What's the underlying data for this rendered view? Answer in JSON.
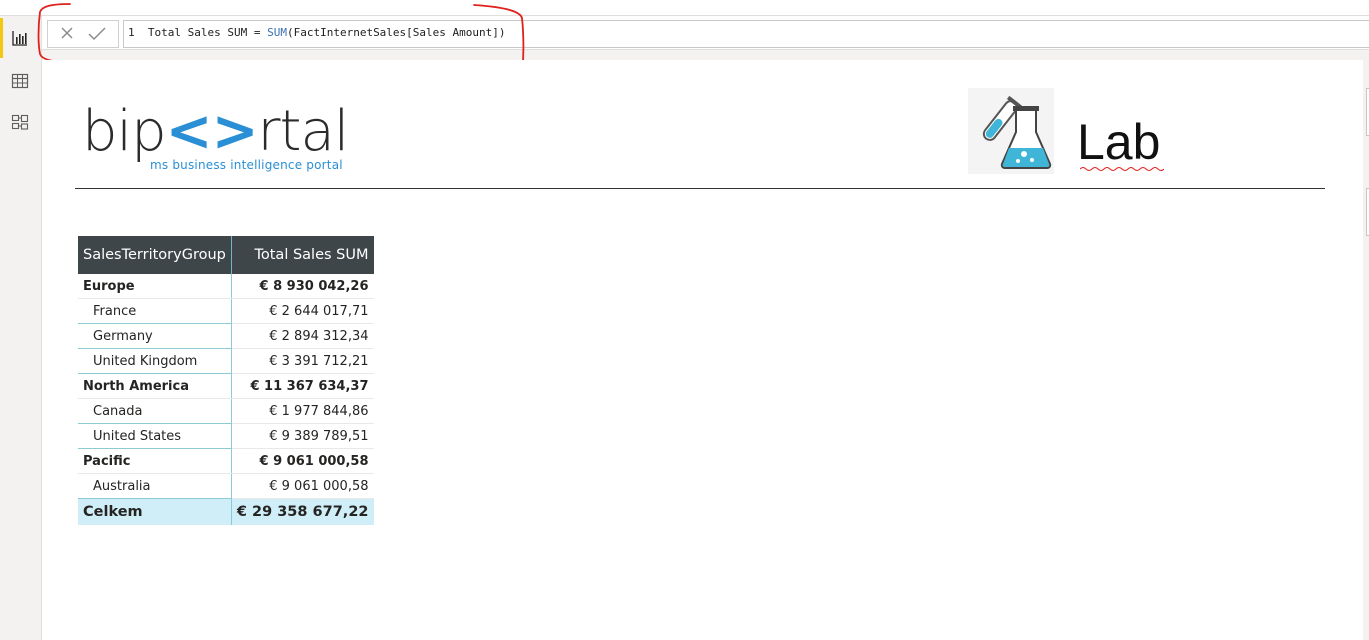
{
  "formula_bar": {
    "line_number": "1",
    "measure_name": "Total Sales SUM",
    "operator": "=",
    "function": "SUM",
    "open_paren": "(",
    "reference": "FactInternetSales[Sales Amount]",
    "close_paren": ")",
    "cancel_icon": "close-icon",
    "commit_icon": "check-icon"
  },
  "nav": {
    "items": [
      {
        "icon": "report-view-icon",
        "active": true
      },
      {
        "icon": "data-view-icon",
        "active": false
      },
      {
        "icon": "model-view-icon",
        "active": false
      }
    ]
  },
  "logo": {
    "part1": "bip",
    "bracket": "<>",
    "part2": "rtal",
    "tagline": "ms business intelligence portal"
  },
  "lab": {
    "label": "Lab",
    "icon": "flask-icon"
  },
  "colors": {
    "accent_yellow": "#f2c811",
    "header_bg": "#3e4649",
    "total_bg": "#cfeef7",
    "annotation_red": "#e0201b",
    "logo_blue": "#2a8fd4"
  },
  "table": {
    "headers": [
      "SalesTerritoryGroup",
      "Total Sales SUM"
    ],
    "rows": [
      {
        "name": "Europe",
        "value": "€ 8 930 042,26",
        "level": "group"
      },
      {
        "name": "France",
        "value": "€ 2 644 017,71",
        "level": "child"
      },
      {
        "name": "Germany",
        "value": "€ 2 894 312,34",
        "level": "child"
      },
      {
        "name": "United Kingdom",
        "value": "€ 3 391 712,21",
        "level": "child"
      },
      {
        "name": "North America",
        "value": "€ 11 367 634,37",
        "level": "group"
      },
      {
        "name": "Canada",
        "value": "€ 1 977 844,86",
        "level": "child"
      },
      {
        "name": "United States",
        "value": "€ 9 389 789,51",
        "level": "child"
      },
      {
        "name": "Pacific",
        "value": "€ 9 061 000,58",
        "level": "group"
      },
      {
        "name": "Australia",
        "value": "€ 9 061 000,58",
        "level": "child"
      }
    ],
    "total": {
      "name": "Celkem",
      "value": "€ 29 358 677,22"
    }
  }
}
